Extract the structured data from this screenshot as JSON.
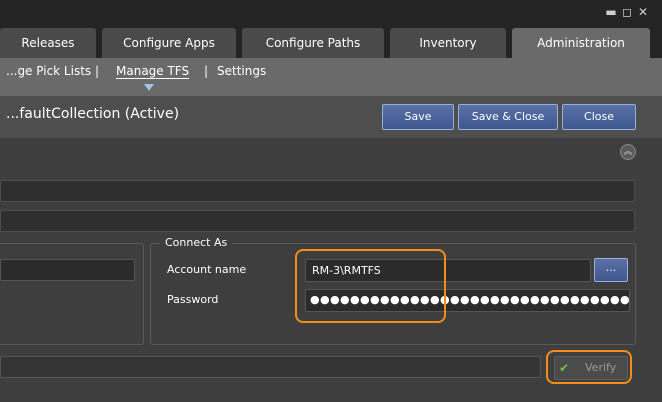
{
  "window": {
    "controls": {
      "minimize": "▬",
      "maximize": "◻",
      "close": "✕"
    }
  },
  "tabs": [
    {
      "label": "Releases"
    },
    {
      "label": "Configure Apps"
    },
    {
      "label": "Configure Paths"
    },
    {
      "label": "Inventory"
    },
    {
      "label": "Administration"
    }
  ],
  "subnav": {
    "items": [
      {
        "label": "...ge Pick Lists"
      },
      {
        "label": "Manage TFS"
      },
      {
        "label": "Settings"
      }
    ],
    "separator": "|"
  },
  "header": {
    "title": "...faultCollection (Active)",
    "save_label": "Save",
    "save_close_label": "Save & Close",
    "close_label": "Close"
  },
  "connect_as": {
    "legend": "Connect As",
    "account_name_label": "Account name",
    "account_name_value": "RM-3\\RMTFS",
    "password_label": "Password",
    "password_value": "●●●●●●●●●●●●●●●●●●●●●●●●●●●●●●●●●●●●●●",
    "browse_label": "..."
  },
  "verify": {
    "label": "Verify",
    "check_icon": "✔"
  },
  "colors": {
    "highlight_orange": "#f28c1a",
    "button_blue": "#4a619a",
    "check_green": "#7ec242"
  }
}
